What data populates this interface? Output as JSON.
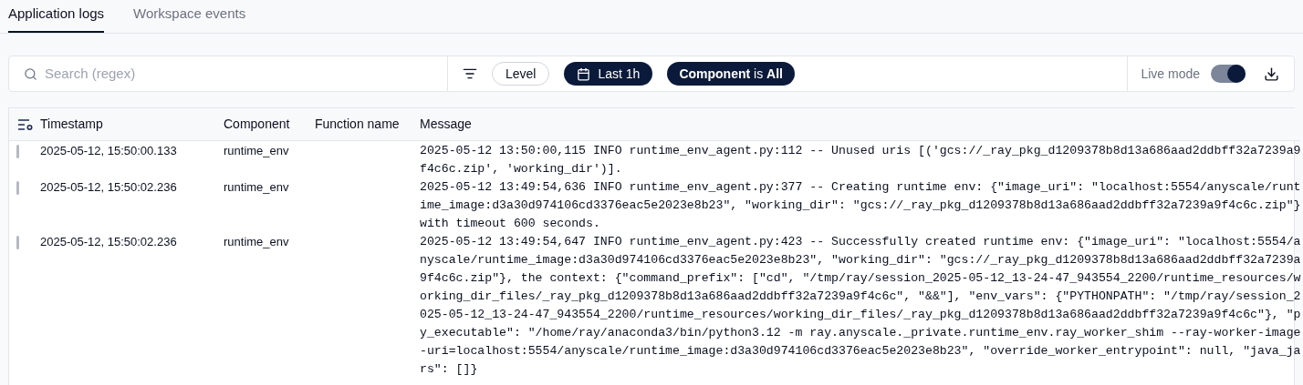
{
  "tabs": [
    {
      "label": "Application logs",
      "selected": true
    },
    {
      "label": "Workspace events",
      "selected": false
    }
  ],
  "toolbar": {
    "search": {
      "placeholder": "Search (regex)"
    },
    "level_filter": "Level",
    "time_filter": "Last 1h",
    "component_filter": "**Component** is **All**",
    "live_mode": {
      "label": "Live mode",
      "on": true
    }
  },
  "table": {
    "columns": [
      "Timestamp",
      "Component",
      "Function name",
      "Message"
    ],
    "rows": [
      {
        "timestamp": "2025-05-12, 15:50:00.133",
        "component": "runtime_env",
        "message": "2025-05-12 13:50:00,115 INFO runtime_env_agent.py:112 -- Unused uris [('gcs://_ray_pkg_d1209378b8d13a686aad2ddbff32a7239a9f4c6c.zip', 'working_dir')]."
      },
      {
        "timestamp": "2025-05-12, 15:50:02.236",
        "component": "runtime_env",
        "message": "2025-05-12 13:49:54,636 INFO runtime_env_agent.py:377 -- Creating runtime env: {\"image_uri\": \"localhost:5554/anyscale/runtime_image:d3a30d974106cd3376eac5e2023e8b23\", \"working_dir\": \"gcs://_ray_pkg_d1209378b8d13a686aad2ddbff32a7239a9f4c6c.zip\"} with timeout 600 seconds."
      },
      {
        "timestamp": "2025-05-12, 15:50:02.236",
        "component": "runtime_env",
        "message": "2025-05-12 13:49:54,647 INFO runtime_env_agent.py:423 -- Successfully created runtime env: {\"image_uri\": \"localhost:5554/anyscale/runtime_image:d3a30d974106cd3376eac5e2023e8b23\", \"working_dir\": \"gcs://_ray_pkg_d1209378b8d13a686aad2ddbff32a7239a9f4c6c.zip\"}, the context: {\"command_prefix\": [\"cd\", \"/tmp/ray/session_2025-05-12_13-24-47_943554_2200/runtime_resources/working_dir_files/_ray_pkg_d1209378b8d13a686aad2ddbff32a7239a9f4c6c\", \"&&\"], \"env_vars\": {\"PYTHONPATH\": \"/tmp/ray/session_2025-05-12_13-24-47_943554_2200/runtime_resources/working_dir_files/_ray_pkg_d1209378b8d13a686aad2ddbff32a7239a9f4c6c\"}, \"py_executable\": \"/home/ray/anaconda3/bin/python3.12 -m ray.anyscale._private.runtime_env.ray_worker_shim --ray-worker-image-uri=localhost:5554/anyscale/runtime_image:d3a30d974106cd3376eac5e2023e8b23\", \"override_worker_entrypoint\": null, \"java_jars\": []}"
      }
    ]
  }
}
